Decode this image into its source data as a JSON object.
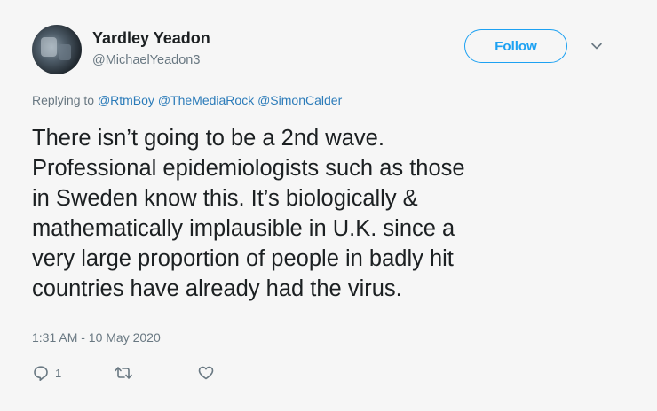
{
  "user": {
    "display_name": "Yardley Yeadon",
    "handle": "@MichaelYeadon3"
  },
  "follow_label": "Follow",
  "replying": {
    "prefix": "Replying to",
    "mentions": [
      "@RtmBoy",
      "@TheMediaRock",
      "@SimonCalder"
    ]
  },
  "tweet": {
    "text": "There isn’t going to be a 2nd wave.\nProfessional epidemiologists such as those\nin Sweden know this. It’s biologically &\nmathematically implausible in U.K. since a\nvery large proportion of people in badly hit\ncountries have already had the virus.",
    "timestamp": "1:31 AM - 10 May 2020"
  },
  "actions": {
    "reply_count": "1",
    "reply_icon": "reply-icon",
    "retweet_icon": "retweet-icon",
    "like_icon": "heart-icon"
  },
  "colors": {
    "accent": "#1da1f2",
    "mention": "#2b7bb9",
    "muted": "#697882",
    "text": "#1c2022"
  }
}
